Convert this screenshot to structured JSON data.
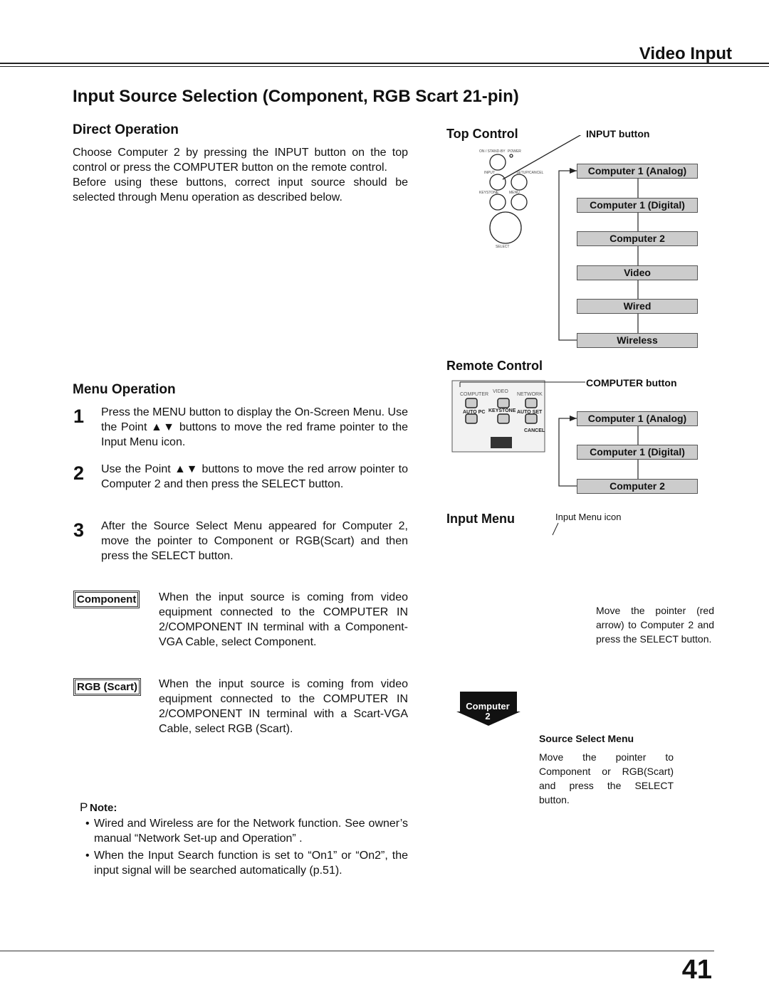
{
  "header": {
    "section": "Video Input"
  },
  "title": "Input Source Selection (Component, RGB Scart 21-pin)",
  "direct": {
    "heading": "Direct Operation",
    "p1": "Choose Computer 2 by pressing the INPUT button on the top control or press the COMPUTER button on the remote control.",
    "p2": "Before using these buttons, correct input source should be selected through Menu operation as described below."
  },
  "top_control": {
    "heading": "Top Control",
    "callout": "INPUT button",
    "sequence": [
      "Computer 1 (Analog)",
      "Computer 1 (Digital)",
      "Computer 2",
      "Video",
      "Wired",
      "Wireless"
    ]
  },
  "remote_control": {
    "heading": "Remote Control",
    "callout": "COMPUTER button",
    "sequence": [
      "Computer 1 (Analog)",
      "Computer 1 (Digital)",
      "Computer 2"
    ]
  },
  "menu": {
    "heading": "Menu Operation",
    "steps": [
      {
        "n": "1",
        "text": "Press the MENU button to display the On-Screen Menu. Use the Point ▲▼ buttons to move the red frame pointer to the Input Menu icon."
      },
      {
        "n": "2",
        "text": "Use the Point ▲▼ buttons to move the red arrow pointer to Computer 2 and then press the SELECT button."
      },
      {
        "n": "3",
        "text": "After the Source Select Menu appeared for Computer 2, move the pointer to Component or RGB(Scart) and then press the SELECT button."
      }
    ]
  },
  "options": [
    {
      "tag": "Component",
      "text": "When the input source is coming from video equipment connected to the COMPUTER IN 2/COMPONENT IN terminal with a Component-VGA Cable, select Component."
    },
    {
      "tag": "RGB (Scart)",
      "text": "When the input source is coming from video equipment connected to the COMPUTER IN 2/COMPONENT IN terminal with a Scart-VGA Cable, select RGB (Scart)."
    }
  ],
  "input_menu": {
    "heading": "Input Menu",
    "icon_label": "Input Menu icon",
    "note": "Move the pointer (red arrow) to Computer 2 and press the SELECT button."
  },
  "arrow_label": {
    "line1": "Computer",
    "line2": "2"
  },
  "source_select": {
    "heading": "Source Select Menu",
    "note": "Move the pointer to Component or RGB(Scart) and press the SELECT button."
  },
  "note": {
    "icon": "P",
    "heading": "Note:",
    "items": [
      "Wired and Wireless are for the Network function. See owner’s manual “Network Set-up and Operation” .",
      "When the Input Search function is set to “On1” or “On2”, the input signal will be searched automatically (p.51)."
    ]
  },
  "page_number": "41"
}
